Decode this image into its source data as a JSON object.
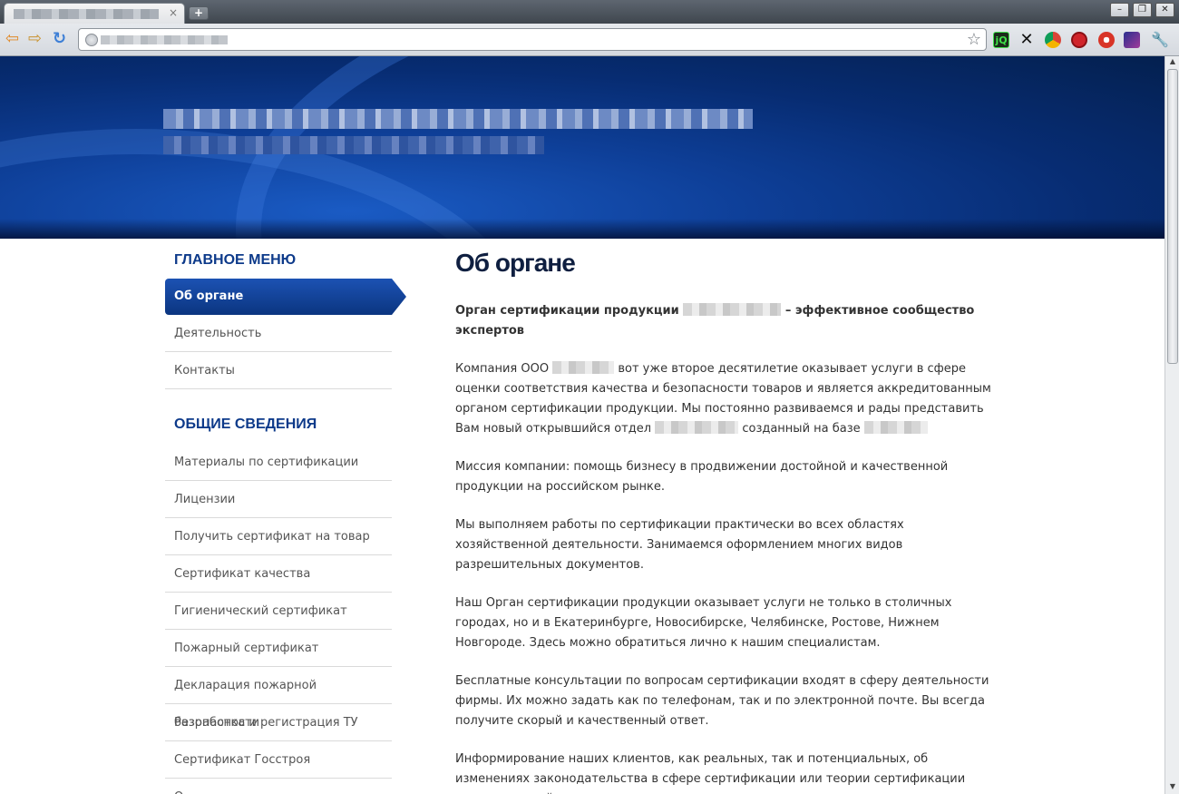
{
  "browser": {
    "new_tab_symbol": "+",
    "close_tab_symbol": "×",
    "window_buttons": [
      "–",
      "❐",
      "✕"
    ],
    "extensions": [
      "jQ",
      "✕"
    ]
  },
  "sidebar": {
    "main_heading": "ГЛАВНОЕ МЕНЮ",
    "main_items": [
      "Об органе",
      "Деятельность",
      "Контакты"
    ],
    "general_heading": "ОБЩИЕ СВЕДЕНИЯ",
    "general_items": [
      "Материалы по сертификации",
      "Лицензии",
      "Получить сертификат на товар",
      "Сертификат качества",
      "Гигиенический сертификат",
      "Пожарный сертификат",
      "Декларация пожарной безопасности",
      "Разработка и регистрация ТУ",
      "Сертификат Госстроя",
      "О..."
    ]
  },
  "content": {
    "title": "Об органе",
    "intro_a": "Орган сертификации продукции",
    "intro_b": "– эффективное сообщество экспертов",
    "p1_a": "Компания ООО",
    "p1_b": "вот уже второе десятилетие оказывает услуги в сфере оценки соответствия качества и безопасности товаров и является аккредитованным органом сертификации продукции. Мы постоянно развиваемся и рады представить Вам новый открывшийся отдел",
    "p1_c": "созданный на базе",
    "p2": "Миссия компании: помощь бизнесу в продвижении достойной и качественной  продукции на российском рынке.",
    "p3": "Мы выполняем работы по сертификации практически во всех областях хозяйственной деятельности. Занимаемся оформлением многих видов разрешительных документов.",
    "p4": "Наш Орган сертификации продукции оказывает услуги не только в столичных городах, но и в Екатеринбурге, Новосибирске, Челябинске, Ростове, Нижнем Новгороде. Здесь можно обратиться лично к нашим специалистам.",
    "p5": "Бесплатные консультации по вопросам сертификации входят в сферу деятельности фирмы. Их можно задать как по телефонам, так и по электронной почте. Вы всегда получите скорый и качественный ответ.",
    "p6": "Информирование наших клиентов, как реальных, так и потенциальных, об изменениях законодательства в сфере сертификации или теории сертификации является одной из важных задач компании."
  }
}
